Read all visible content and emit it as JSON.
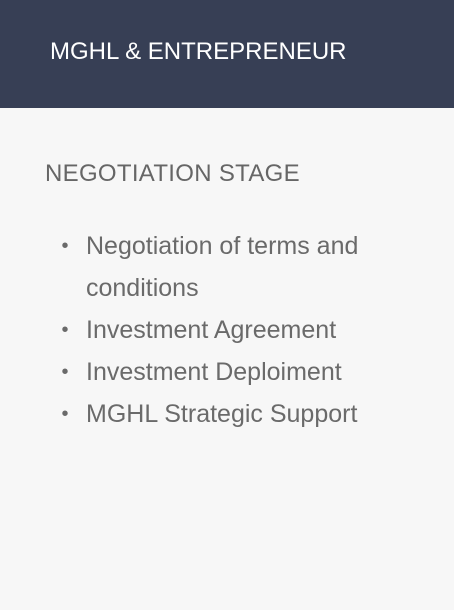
{
  "header": {
    "title": "MGHL & ENTREPRENEUR"
  },
  "section": {
    "title": "NEGOTIATION STAGE",
    "items": [
      {
        "label": "Negotiation of terms and conditions",
        "bullet_icon": "bullet-dot-icon"
      },
      {
        "label": "Investment Agreement",
        "bullet_icon": "bullet-dot-icon"
      },
      {
        "label": "Investment Deploiment",
        "bullet_icon": "bullet-dot-icon"
      },
      {
        "label": "MGHL Strategic Support",
        "bullet_icon": "bullet-dot-icon"
      }
    ]
  },
  "colors": {
    "header_bg": "#373f55",
    "body_bg": "#f7f7f7",
    "text": "#6a6a6a",
    "header_text": "#ffffff"
  }
}
